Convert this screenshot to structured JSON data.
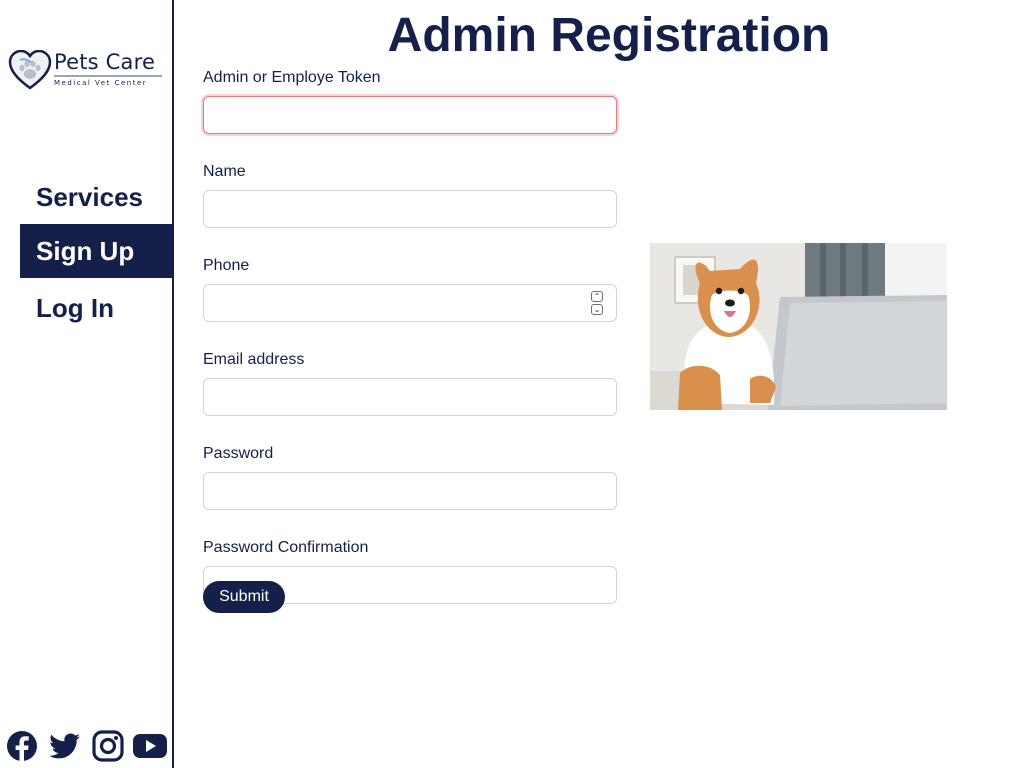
{
  "brand": {
    "name": "Pets Care",
    "tagline": "Medical Vet Center",
    "colors": {
      "primary": "#15204a",
      "focus_border": "#e07a80"
    }
  },
  "nav": {
    "items": [
      {
        "label": "Services",
        "active": false
      },
      {
        "label": "Sign Up",
        "active": true
      },
      {
        "label": "Log In",
        "active": false
      }
    ]
  },
  "social": {
    "icons": [
      "facebook-icon",
      "twitter-icon",
      "instagram-icon",
      "youtube-icon"
    ]
  },
  "page": {
    "title": "Admin Registration"
  },
  "form": {
    "token_label": "Admin or Employe Token",
    "token_value": "",
    "name_label": "Name",
    "name_value": "",
    "phone_label": "Phone",
    "phone_value": "",
    "email_label": "Email address",
    "email_value": "",
    "password_label": "Password",
    "password_value": "",
    "password_confirm_label": "Password Confirmation",
    "password_confirm_value": "",
    "submit_label": "Submit"
  },
  "image": {
    "subject": "corgi dog with laptop"
  }
}
